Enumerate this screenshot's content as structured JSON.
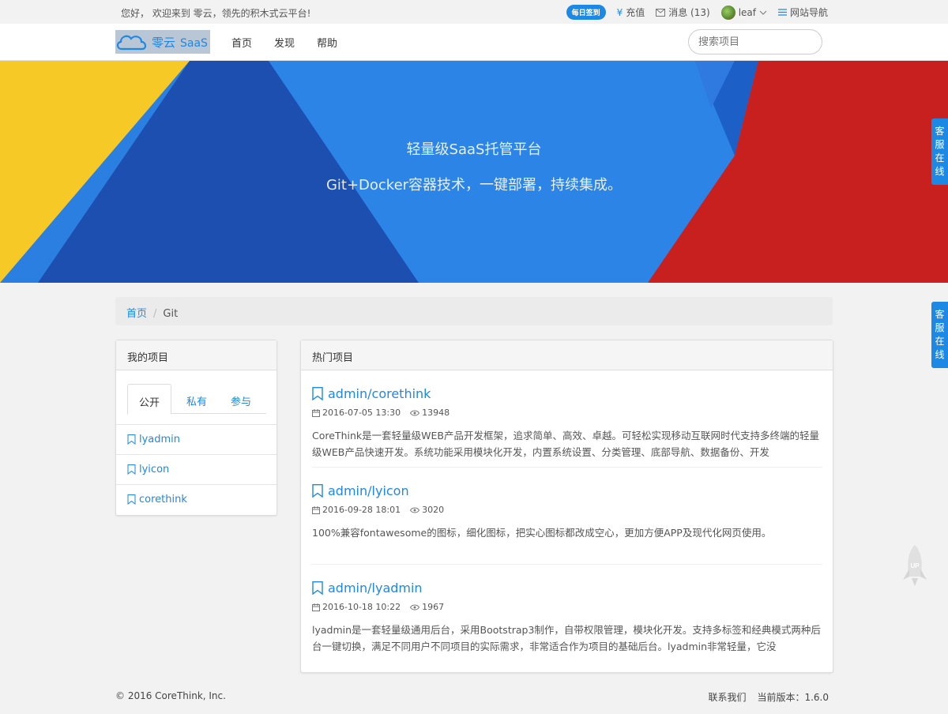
{
  "topbar": {
    "welcome": "您好， 欢迎来到 零云，领先的积木式云平台!",
    "checkin": "每日签到",
    "recharge": "充值",
    "messages": "消息 (13)",
    "username": "leaf",
    "site_nav": "网站导航"
  },
  "navbar": {
    "logo_text1": "零云",
    "logo_text2": "SaaS",
    "links": [
      "首页",
      "发现",
      "帮助"
    ],
    "search_placeholder": "搜索项目"
  },
  "banner": {
    "title": "轻量级SaaS托管平台",
    "subtitle": "Git+Docker容器技术，一键部署，持续集成。"
  },
  "float": {
    "kf1": "客服在线",
    "kf2": "客服在线"
  },
  "breadcrumb": {
    "home": "首页",
    "sep": "/",
    "current": "Git"
  },
  "my_projects": {
    "title": "我的项目",
    "tabs": [
      "公开",
      "私有",
      "参与"
    ],
    "items": [
      "lyadmin",
      "lyicon",
      "corethink"
    ]
  },
  "hot_projects": {
    "title": "热门项目",
    "items": [
      {
        "name": "admin/corethink",
        "date": "2016-07-05 13:30",
        "views": "13948",
        "desc": "CoreThink是一套轻量级WEB产品开发框架，追求简单、高效、卓越。可轻松实现移动互联网时代支持多终端的轻量级WEB产品快速开发。系统功能采用模块化开发，内置系统设置、分类管理、底部导航、数据备份、开发"
      },
      {
        "name": "admin/lyicon",
        "date": "2016-09-28 18:01",
        "views": "3020",
        "desc": "100%兼容fontawesome的图标，细化图标，把实心图标都改成空心，更加方便APP及现代化网页使用。"
      },
      {
        "name": "admin/lyadmin",
        "date": "2016-10-18 10:22",
        "views": "1967",
        "desc": "lyadmin是一套轻量级通用后台，采用Bootstrap3制作，自带权限管理，模块化开发。支持多标签和经典模式两种后台一键切换，满足不同用户不同项目的实际需求，非常适合作为项目的基础后台。lyadmin非常轻量，它没"
      }
    ]
  },
  "footer": {
    "copyright": "© 2016 CoreThink, Inc.",
    "contact": "联系我们",
    "version": "当前版本：1.6.0"
  },
  "rocket_label": "UP",
  "colors": {
    "accent": "#1e88e5",
    "banner_yellow": "#f6c927",
    "banner_blue": "#2b7fe0",
    "banner_red": "#c8201f"
  }
}
